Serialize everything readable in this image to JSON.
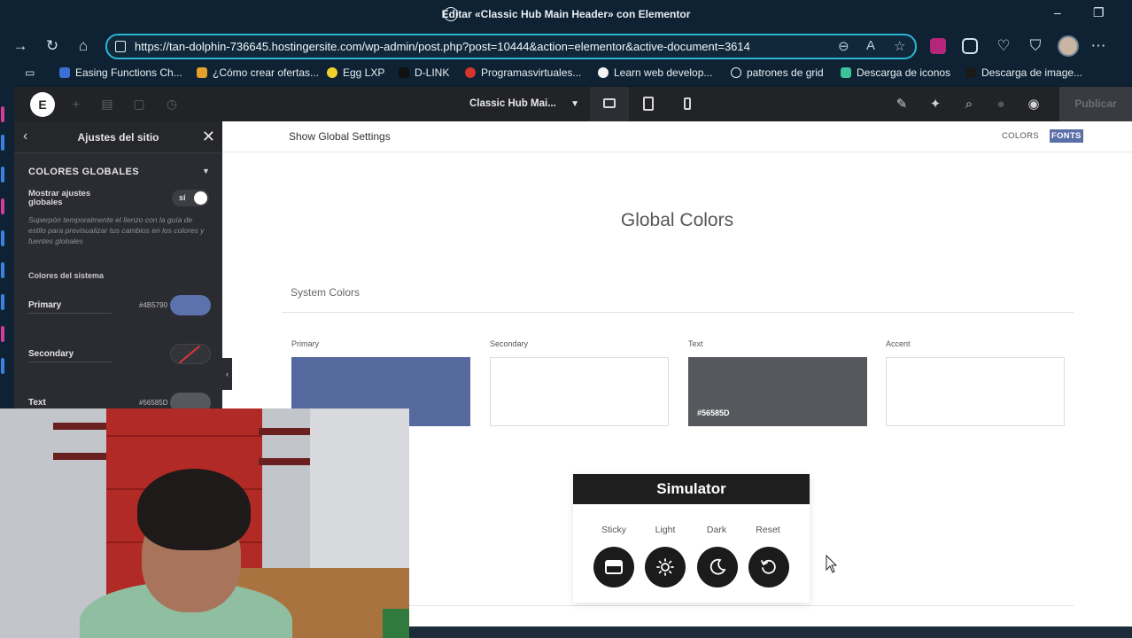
{
  "browser": {
    "window_title": "Editar «Classic Hub Main Header» con Elementor",
    "url": "https://tan-dolphin-736645.hostingersite.com/wp-admin/post.php?post=10444&action=elementor&active-document=3614",
    "bookmarks": [
      "Easing Functions Ch...",
      "¿Cómo crear ofertas...",
      "Egg LXP",
      "D-LINK",
      "Programasvirtuales...",
      "Learn web develop...",
      "patrones de grid",
      "Descarga de iconos",
      "Descarga de image..."
    ]
  },
  "topbar": {
    "logo": "E",
    "document_name": "Classic Hub Mai...",
    "publish_label": "Publicar"
  },
  "panel": {
    "title": "Ajustes del sitio",
    "section_title": "COLORES GLOBALES",
    "toggle_label": "Mostrar ajustes globales",
    "toggle_value": "sí",
    "toggle_description": "Superpón temporalmente el lienzo con la guía de estilo para previsualizar tus cambios en los colores y fuentes globales",
    "system_colors_label": "Colores del sistema",
    "colors": [
      {
        "name": "Primary",
        "hex": "#4B5790",
        "swatch": "#5b72ad"
      },
      {
        "name": "Secondary",
        "hex": "",
        "swatch": ""
      },
      {
        "name": "Text",
        "hex": "#56585D",
        "swatch": "#56585d"
      }
    ]
  },
  "canvas": {
    "show_global_settings": "Show Global Settings",
    "link_colors": "COLORS",
    "link_fonts": "FONTS",
    "title": "Global Colors",
    "system_colors_title": "System Colors",
    "cards": [
      {
        "label": "Primary",
        "hex": "",
        "color": "#55699f"
      },
      {
        "label": "Secondary",
        "hex": "",
        "color": "#ffffff"
      },
      {
        "label": "Text",
        "hex": "#56585D",
        "color": "#56585d"
      },
      {
        "label": "Accent",
        "hex": "",
        "color": "#ffffff"
      }
    ]
  },
  "simulator": {
    "title": "Simulator",
    "buttons": [
      {
        "label": "Sticky",
        "icon": "sticky-header-icon"
      },
      {
        "label": "Light",
        "icon": "sun-icon"
      },
      {
        "label": "Dark",
        "icon": "moon-icon"
      },
      {
        "label": "Reset",
        "icon": "reset-icon"
      }
    ]
  }
}
